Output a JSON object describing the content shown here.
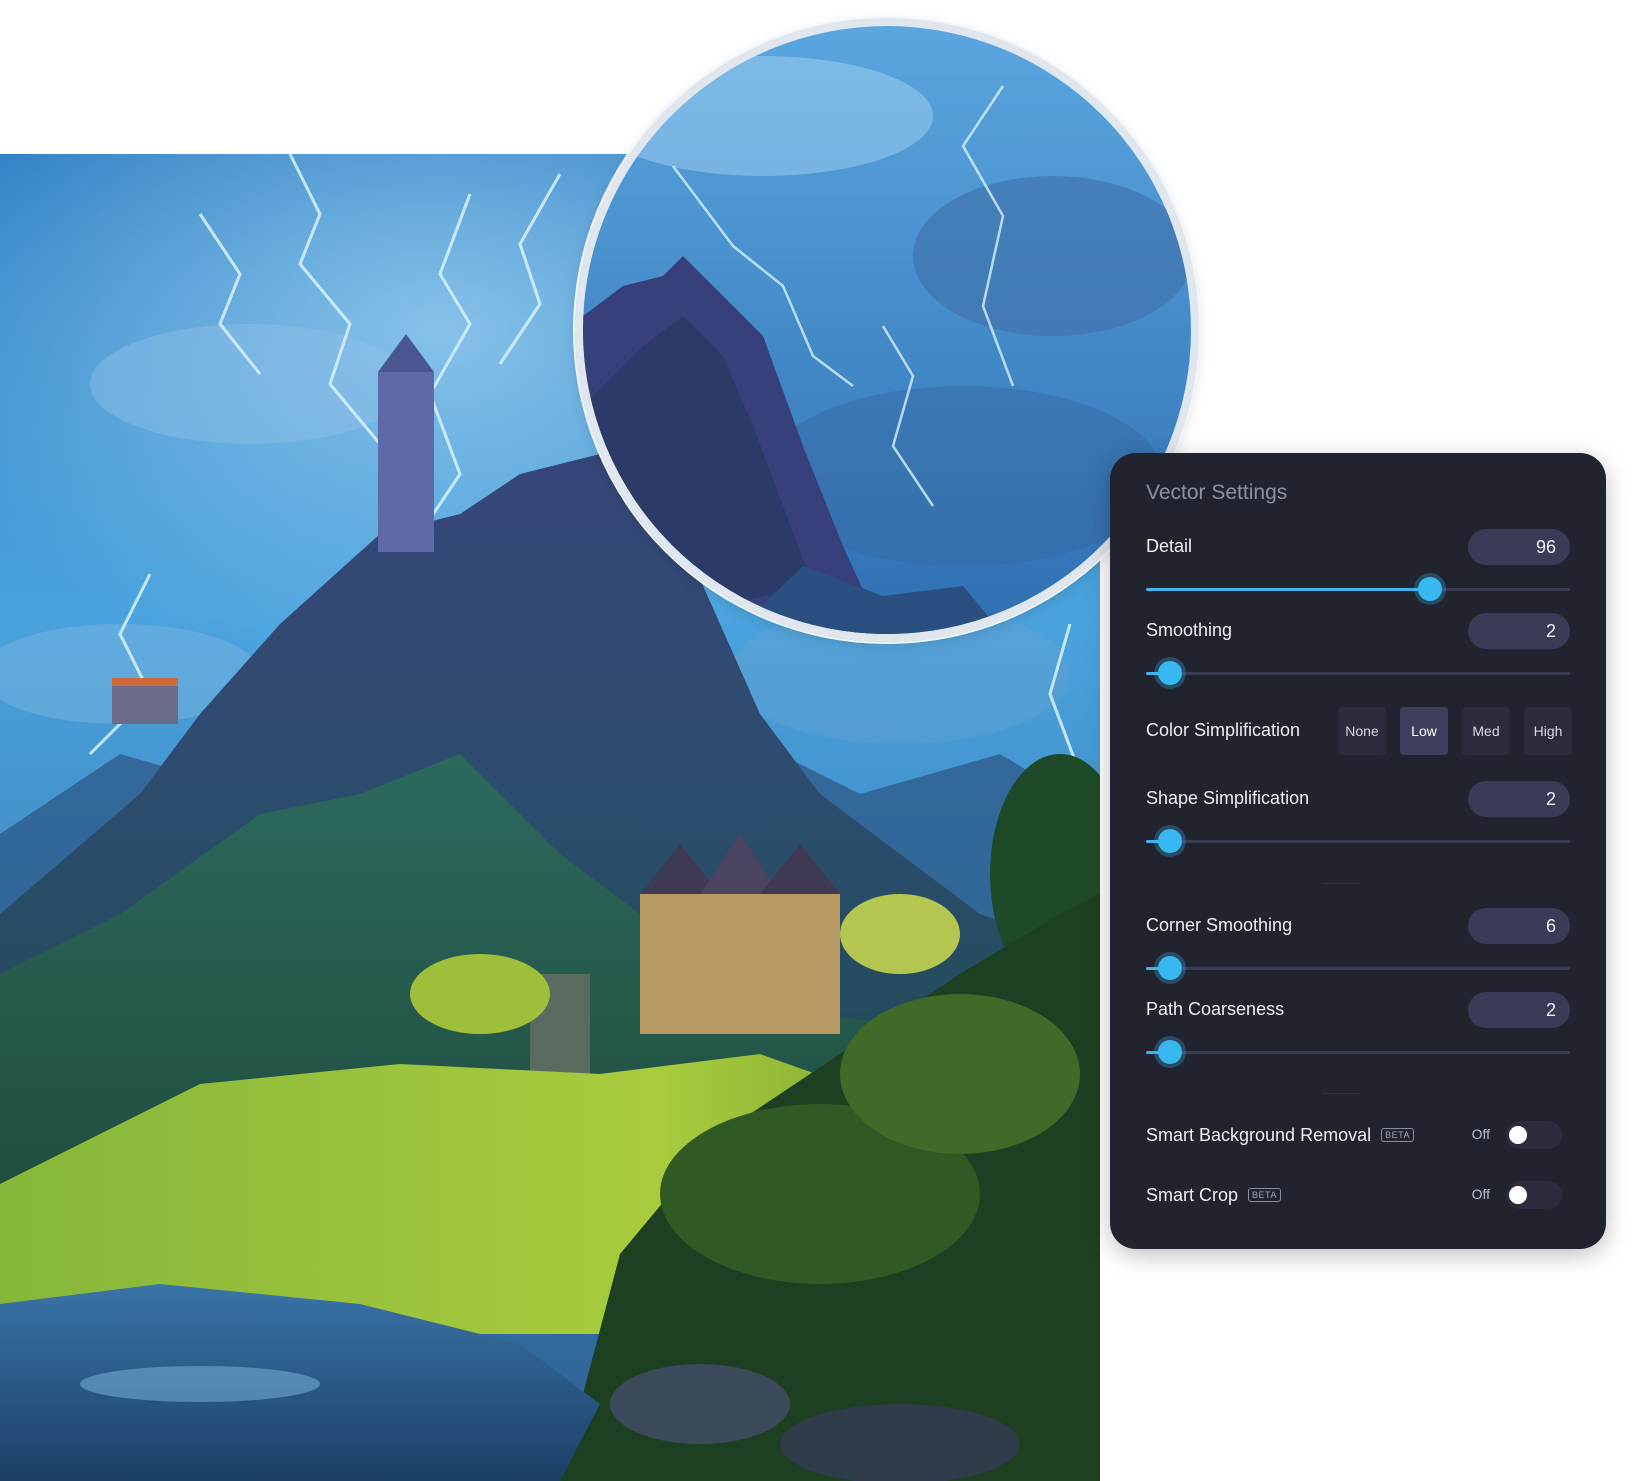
{
  "panel": {
    "title": "Vector Settings",
    "detail": {
      "label": "Detail",
      "value": "96",
      "level": 0.65
    },
    "smoothing": {
      "label": "Smoothing",
      "value": "2",
      "level": 0.0
    },
    "color_simplification": {
      "label": "Color Simplification",
      "options": [
        "None",
        "Low",
        "Med",
        "High"
      ],
      "selected": "Low"
    },
    "shape_simplification": {
      "label": "Shape Simplification",
      "value": "2",
      "level": 0.0
    },
    "corner_smoothing": {
      "label": "Corner Smoothing",
      "value": "6",
      "level": 0.0
    },
    "path_coarseness": {
      "label": "Path Coarseness",
      "value": "2",
      "level": 0.0
    },
    "smart_background_removal": {
      "label": "Smart Background Removal",
      "badge": "BETA",
      "state": "Off"
    },
    "smart_crop": {
      "label": "Smart Crop",
      "badge": "BETA",
      "state": "Off"
    }
  },
  "colors": {
    "panel_bg": "#21232f",
    "accent": "#38b8f0",
    "pill_bg": "#3a3c57"
  }
}
